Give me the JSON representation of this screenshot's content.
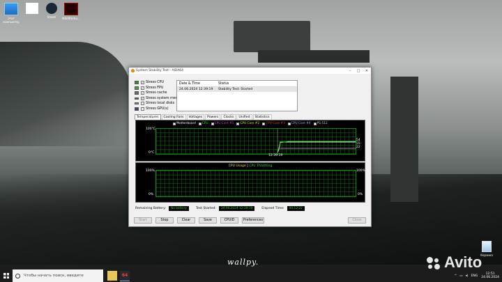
{
  "desktop": {
    "icons": [
      {
        "label": "Этот компьютер"
      },
      {
        "label": ""
      },
      {
        "label": "Steam"
      },
      {
        "label": "MSIAfterbu..."
      }
    ],
    "watermark": "wallpy.",
    "recycle_bin": "Корзина"
  },
  "window": {
    "title": "System Stability Test - AIDA64",
    "stress_items": [
      {
        "label": "Stress CPU",
        "checked": true
      },
      {
        "label": "Stress FPU",
        "checked": true
      },
      {
        "label": "Stress cache",
        "checked": true
      },
      {
        "label": "Stress system memory",
        "checked": true
      },
      {
        "label": "Stress local disks",
        "checked": false
      },
      {
        "label": "Stress GPU(s)",
        "checked": false
      }
    ],
    "status_table": {
      "headers": [
        "Date & Time",
        "Status"
      ],
      "rows": [
        [
          "24.06.2024 12:39:19",
          "Stability Test: Started"
        ]
      ]
    },
    "tabs": [
      "Temperatures",
      "Cooling Fans",
      "Voltages",
      "Powers",
      "Clocks",
      "Unified",
      "Statistics"
    ],
    "active_tab": "Temperatures",
    "temp_legend": [
      "Motherboard",
      "CPU",
      "CPU Core #1",
      "CPU Core #2",
      "CPU Core #3",
      "CPU Core #4",
      "PS-512"
    ],
    "temp_axis": {
      "top": "100°C",
      "bottom": "0°C",
      "time": "12:39:19"
    },
    "temp_readouts": [
      "54",
      "55",
      "22"
    ],
    "usage_title_a": "CPU Usage",
    "usage_title_sep": "|",
    "usage_title_b": "CPU Throttling",
    "usage_axis": {
      "top": "100%",
      "bottom": "0%",
      "right_top": "100%",
      "right_bottom": "0%"
    },
    "bottom": {
      "battery_label": "Remaining Battery:",
      "battery_value": "No battery",
      "started_label": "Test Started:",
      "started_value": "24.06.2024 12:39:19",
      "elapsed_label": "Elapsed Time:",
      "elapsed_value": "00:12:22"
    },
    "buttons": {
      "start": "Start",
      "stop": "Stop",
      "clear": "Clear",
      "save": "Save",
      "cpuid": "CPUID",
      "preferences": "Preferences",
      "close": "Close"
    }
  },
  "taskbar": {
    "search_placeholder": "Чтобы начать поиск, введите",
    "app_badge": "64",
    "lang": "ENG",
    "time": "12:51",
    "date": "24.06.2024"
  },
  "colors": {
    "graph_bg": "#000000",
    "grid": "#007000",
    "value_green": "#2fd12f"
  },
  "brand": "Avito"
}
